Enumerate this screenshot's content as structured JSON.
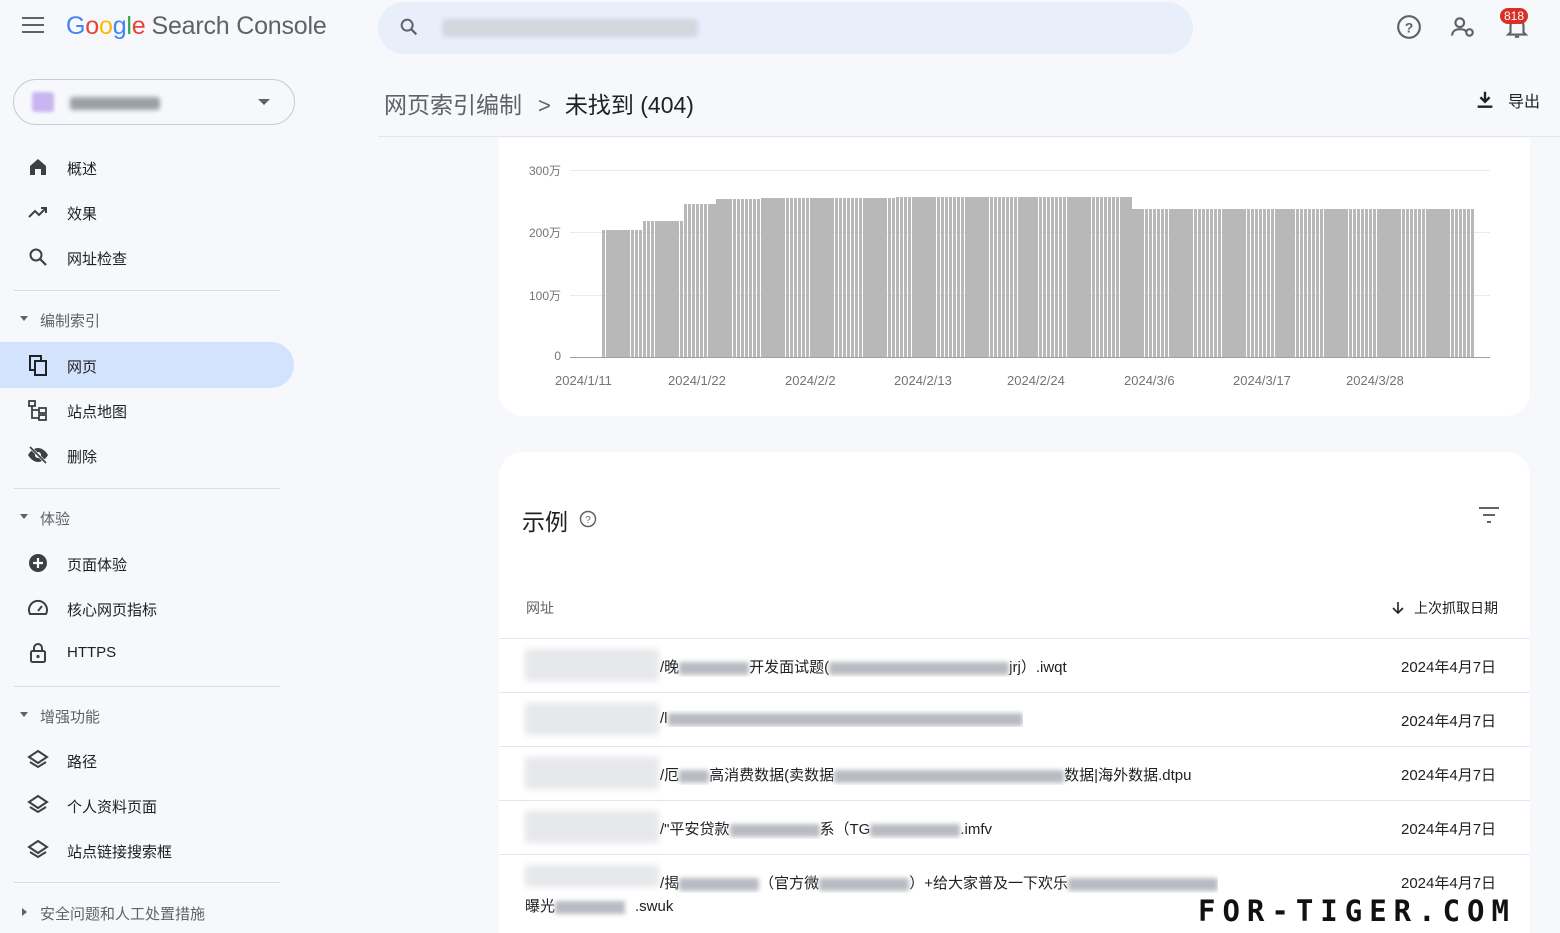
{
  "app": {
    "logo_google": [
      "G",
      "o",
      "o",
      "g",
      "l",
      "e"
    ],
    "logo_product": "Search Console",
    "notification_count": "818"
  },
  "sidebar": {
    "top_items": [
      {
        "label": "概述",
        "icon": "home-icon"
      },
      {
        "label": "效果",
        "icon": "trending-up-icon"
      },
      {
        "label": "网址检查",
        "icon": "search-icon"
      }
    ],
    "sections": [
      {
        "title": "编制索引",
        "items": [
          {
            "label": "网页",
            "icon": "pages-icon",
            "active": true
          },
          {
            "label": "站点地图",
            "icon": "sitemap-icon"
          },
          {
            "label": "删除",
            "icon": "eye-off-icon"
          }
        ]
      },
      {
        "title": "体验",
        "items": [
          {
            "label": "页面体验",
            "icon": "add-circle-icon"
          },
          {
            "label": "核心网页指标",
            "icon": "speed-gauge-icon"
          },
          {
            "label": "HTTPS",
            "icon": "lock-icon"
          }
        ]
      },
      {
        "title": "增强功能",
        "items": [
          {
            "label": "路径",
            "icon": "layers-icon"
          },
          {
            "label": "个人资料页面",
            "icon": "layers-icon"
          },
          {
            "label": "站点链接搜索框",
            "icon": "layers-icon"
          }
        ]
      },
      {
        "title": "安全问题和人工处置措施",
        "collapsed": true
      }
    ]
  },
  "header": {
    "breadcrumb_parent": "网页索引编制",
    "breadcrumb_separator": ">",
    "breadcrumb_current": "未找到 (404)",
    "export_label": "导出"
  },
  "chart_data": {
    "type": "bar",
    "y_tick_labels": [
      "300万",
      "200万",
      "100万",
      "0"
    ],
    "y_ticks": [
      3000000,
      2000000,
      1000000,
      0
    ],
    "ylim": [
      0,
      3000000
    ],
    "x_tick_labels": [
      "2024/1/11",
      "2024/1/22",
      "2024/2/2",
      "2024/2/13",
      "2024/2/24",
      "2024/3/6",
      "2024/3/17",
      "2024/3/28"
    ],
    "values": [
      2030000,
      2030000,
      2030000,
      2030000,
      2030000,
      2030000,
      2030000,
      2030000,
      2030000,
      2030000,
      2180000,
      2180000,
      2180000,
      2180000,
      2180000,
      2180000,
      2180000,
      2180000,
      2180000,
      2180000,
      2460000,
      2460000,
      2460000,
      2460000,
      2460000,
      2460000,
      2460000,
      2460000,
      2540000,
      2540000,
      2540000,
      2540000,
      2540000,
      2540000,
      2540000,
      2540000,
      2540000,
      2540000,
      2540000,
      2550000,
      2550000,
      2550000,
      2550000,
      2550000,
      2550000,
      2550000,
      2550000,
      2550000,
      2550000,
      2550000,
      2550000,
      2550000,
      2550000,
      2550000,
      2550000,
      2550000,
      2550000,
      2550000,
      2550000,
      2550000,
      2550000,
      2550000,
      2550000,
      2550000,
      2550000,
      2550000,
      2550000,
      2550000,
      2550000,
      2550000,
      2550000,
      2550000,
      2570000,
      2570000,
      2570000,
      2570000,
      2570000,
      2570000,
      2570000,
      2570000,
      2570000,
      2570000,
      2570000,
      2570000,
      2570000,
      2570000,
      2570000,
      2570000,
      2570000,
      2570000,
      2570000,
      2570000,
      2570000,
      2570000,
      2570000,
      2570000,
      2570000,
      2570000,
      2570000,
      2570000,
      2570000,
      2570000,
      2570000,
      2570000,
      2570000,
      2570000,
      2570000,
      2570000,
      2570000,
      2570000,
      2570000,
      2570000,
      2570000,
      2570000,
      2570000,
      2570000,
      2570000,
      2570000,
      2570000,
      2570000,
      2570000,
      2570000,
      2570000,
      2570000,
      2570000,
      2570000,
      2570000,
      2570000,
      2570000,
      2570000,
      2370000,
      2370000,
      2370000,
      2370000,
      2370000,
      2370000,
      2370000,
      2370000,
      2370000,
      2370000,
      2370000,
      2370000,
      2370000,
      2370000,
      2370000,
      2370000,
      2370000,
      2370000,
      2370000,
      2370000,
      2370000,
      2370000,
      2370000,
      2370000,
      2370000,
      2370000,
      2370000,
      2370000,
      2370000,
      2370000,
      2370000,
      2370000,
      2370000,
      2370000,
      2370000,
      2370000,
      2370000,
      2370000,
      2370000,
      2370000,
      2370000,
      2370000,
      2370000,
      2370000,
      2370000,
      2370000,
      2370000,
      2370000,
      2370000,
      2370000,
      2370000,
      2370000,
      2370000,
      2370000,
      2370000,
      2370000,
      2370000,
      2370000,
      2370000,
      2370000,
      2370000,
      2370000,
      2370000,
      2370000,
      2370000,
      2370000,
      2370000,
      2370000,
      2370000,
      2370000,
      2370000,
      2370000,
      2370000,
      2370000,
      2370000,
      2370000,
      2370000,
      2370000,
      2370000,
      2370000,
      2370000,
      2370000,
      2370000,
      2370000
    ],
    "bar_color": "#b8b8b8",
    "grid": true
  },
  "examples": {
    "title": "示例",
    "col_url": "网址",
    "col_date": "上次抓取日期",
    "rows": [
      {
        "url_prefix": "/晚",
        "url_mid": "开发面试题(",
        "url_end": "jrj）.iwqt",
        "date": "2024年4月7日"
      },
      {
        "url_prefix": "/l",
        "url_mid": "",
        "url_end": "",
        "date": "2024年4月7日"
      },
      {
        "url_prefix": "/厄",
        "url_mid": "高消费数据(卖数据",
        "url_end": "数据|海外数据.dtpu",
        "date": "2024年4月7日"
      },
      {
        "url_prefix": "/\"平安贷款",
        "url_mid": "系（TG",
        "url_end": ".imfv",
        "date": "2024年4月7日"
      },
      {
        "url_prefix": "/揭",
        "url_mid": "（官方微",
        "url_end": "）+给大家普及一下欢乐",
        "date": "2024年4月7日",
        "line2_prefix": "曝光",
        "line2_end": ".swuk"
      }
    ]
  },
  "watermark": "FOR-TIGER.COM"
}
